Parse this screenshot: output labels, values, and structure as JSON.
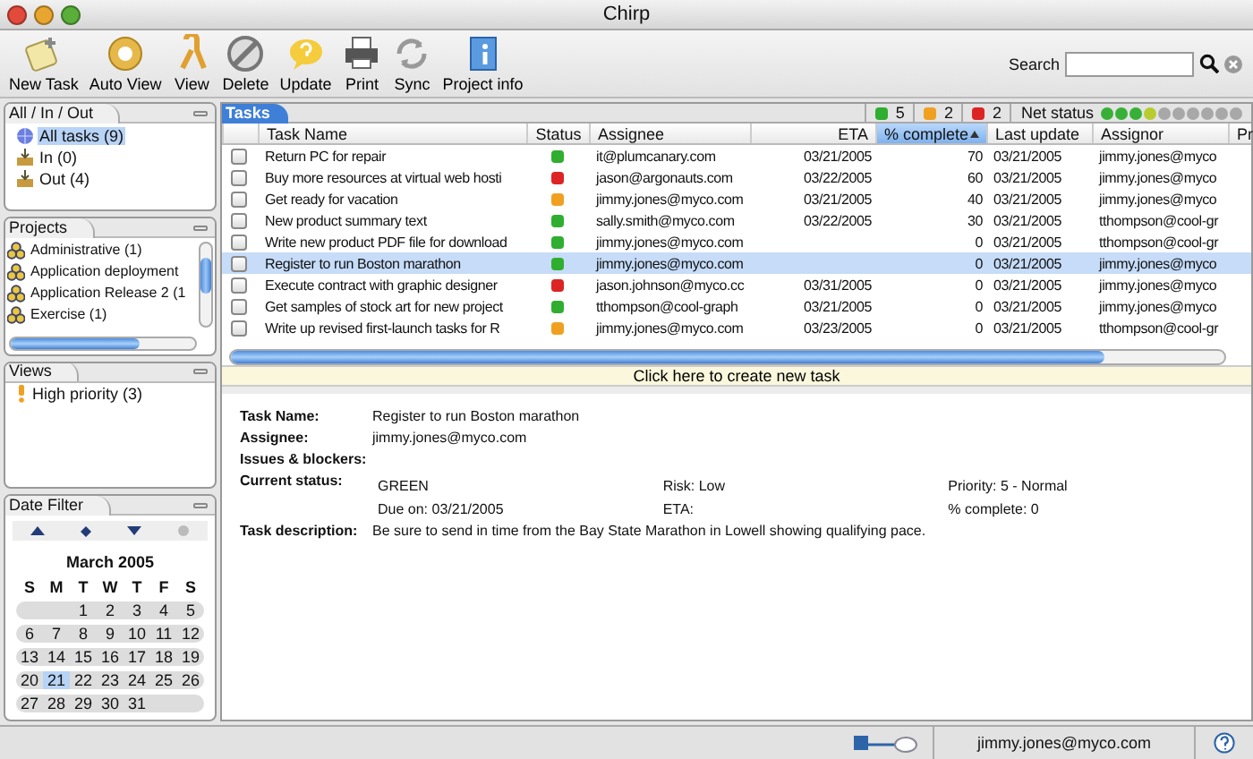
{
  "window": {
    "title": "Chirp"
  },
  "toolbar": [
    {
      "label": "New Task",
      "kind": "new"
    },
    {
      "label": "Auto View",
      "kind": "auto"
    },
    {
      "label": "View",
      "kind": "view"
    },
    {
      "label": "Delete",
      "kind": "delete"
    },
    {
      "label": "Update",
      "kind": "update"
    },
    {
      "label": "Print",
      "kind": "print"
    },
    {
      "label": "Sync",
      "kind": "sync"
    },
    {
      "label": "Project info",
      "kind": "info"
    }
  ],
  "search": {
    "label": "Search"
  },
  "sidebar": [
    {
      "title": "All / In / Out",
      "kind": "list",
      "items": [
        {
          "label": "All tasks (9)",
          "kind": "globe",
          "selected": true
        },
        {
          "label": "In (0)",
          "kind": "tray",
          "selected": false
        },
        {
          "label": "Out (4)",
          "kind": "tray",
          "selected": false
        }
      ]
    },
    {
      "title": "Projects",
      "kind": "scroll",
      "items": [
        {
          "label": "Administrative (1)",
          "kind": "project",
          "selected": false
        },
        {
          "label": "Application deployment",
          "kind": "project",
          "selected": false
        },
        {
          "label": "Application Release 2 (1",
          "kind": "project",
          "selected": false
        },
        {
          "label": "Exercise (1)",
          "kind": "project",
          "selected": false
        }
      ]
    },
    {
      "title": "Views",
      "kind": "list",
      "items": [
        {
          "label": "High priority (3)",
          "kind": "priority",
          "selected": false
        }
      ]
    }
  ],
  "date_filter": {
    "title": "Date Filter",
    "month": "March 2005",
    "weekdays": [
      "S",
      "M",
      "T",
      "W",
      "T",
      "F",
      "S"
    ],
    "weeks": [
      [
        {
          "day": "1",
          "selected": false
        },
        {
          "day": "2",
          "selected": false
        },
        {
          "day": "3",
          "selected": false
        },
        {
          "day": "4",
          "selected": false
        },
        {
          "day": "5",
          "selected": false
        }
      ],
      [
        {
          "day": "6",
          "selected": false
        },
        {
          "day": "7",
          "selected": false
        },
        {
          "day": "8",
          "selected": false
        },
        {
          "day": "9",
          "selected": false
        },
        {
          "day": "10",
          "selected": false
        },
        {
          "day": "11",
          "selected": false
        },
        {
          "day": "12",
          "selected": false
        }
      ],
      [
        {
          "day": "13",
          "selected": false
        },
        {
          "day": "14",
          "selected": false
        },
        {
          "day": "15",
          "selected": false
        },
        {
          "day": "16",
          "selected": false
        },
        {
          "day": "17",
          "selected": false
        },
        {
          "day": "18",
          "selected": false
        },
        {
          "day": "19",
          "selected": false
        }
      ],
      [
        {
          "day": "20",
          "selected": false
        },
        {
          "day": "21",
          "selected": true
        },
        {
          "day": "22",
          "selected": false
        },
        {
          "day": "23",
          "selected": false
        },
        {
          "day": "24",
          "selected": false
        },
        {
          "day": "25",
          "selected": false
        },
        {
          "day": "26",
          "selected": false
        }
      ],
      [
        {
          "day": "27",
          "selected": false
        },
        {
          "day": "28",
          "selected": false
        },
        {
          "day": "29",
          "selected": false
        },
        {
          "day": "30",
          "selected": false
        },
        {
          "day": "31",
          "selected": false
        }
      ]
    ]
  },
  "tasks": {
    "tab": "Tasks",
    "counts": [
      {
        "count": "5",
        "color": "#2fae2f"
      },
      {
        "count": "2",
        "color": "#f0a020"
      },
      {
        "count": "2",
        "color": "#dd2424"
      }
    ],
    "net_status": {
      "label": "Net status",
      "dots": [
        {
          "color": "#38b038"
        },
        {
          "color": "#38b038"
        },
        {
          "color": "#38b038"
        },
        {
          "color": "#b8cc30"
        },
        {
          "color": "#a8a8a8"
        },
        {
          "color": "#a8a8a8"
        },
        {
          "color": "#a8a8a8"
        },
        {
          "color": "#a8a8a8"
        },
        {
          "color": "#a8a8a8"
        },
        {
          "color": "#a8a8a8"
        }
      ]
    },
    "columns": [
      {
        "label": "Task Name",
        "selected": false
      },
      {
        "label": "Status",
        "selected": false
      },
      {
        "label": "Assignee",
        "selected": false
      },
      {
        "label": "ETA",
        "selected": false
      },
      {
        "label": "% complete",
        "selected": true
      },
      {
        "label": "Last update",
        "selected": false
      },
      {
        "label": "Assignor",
        "selected": false
      },
      {
        "label": "Pr",
        "selected": false
      }
    ],
    "rows": [
      {
        "checked": false,
        "selected": false,
        "name": "Return  PC for repair",
        "color": "#2fae2f",
        "assignee": "it@plumcanary.com",
        "eta": "03/21/2005",
        "complete": "70",
        "last_update": "03/21/2005",
        "assignor": "jimmy.jones@myco"
      },
      {
        "checked": false,
        "selected": false,
        "name": "Buy more resources at virtual web hosti",
        "color": "#dd2424",
        "assignee": "jason@argonauts.com",
        "eta": "03/22/2005",
        "complete": "60",
        "last_update": "03/21/2005",
        "assignor": "jimmy.jones@myco"
      },
      {
        "checked": false,
        "selected": false,
        "name": "Get ready for vacation",
        "color": "#f0a020",
        "assignee": "jimmy.jones@myco.com",
        "eta": "03/21/2005",
        "complete": "40",
        "last_update": "03/21/2005",
        "assignor": "jimmy.jones@myco"
      },
      {
        "checked": false,
        "selected": false,
        "name": "New product summary text",
        "color": "#2fae2f",
        "assignee": "sally.smith@myco.com",
        "eta": "03/22/2005",
        "complete": "30",
        "last_update": "03/21/2005",
        "assignor": "tthompson@cool-gr"
      },
      {
        "checked": false,
        "selected": false,
        "name": "Write new product PDF file for download",
        "color": "#2fae2f",
        "assignee": "jimmy.jones@myco.com",
        "complete": "0",
        "last_update": "03/21/2005",
        "assignor": "tthompson@cool-gr"
      },
      {
        "checked": false,
        "selected": true,
        "name": "Register to run Boston marathon",
        "color": "#2fae2f",
        "assignee": "jimmy.jones@myco.com",
        "complete": "0",
        "last_update": "03/21/2005",
        "assignor": "jimmy.jones@myco"
      },
      {
        "checked": false,
        "selected": false,
        "name": "Execute contract with graphic designer",
        "color": "#dd2424",
        "assignee": "jason.johnson@myco.cc",
        "eta": "03/31/2005",
        "complete": "0",
        "last_update": "03/21/2005",
        "assignor": "jimmy.jones@myco"
      },
      {
        "checked": false,
        "selected": false,
        "name": "Get samples of stock art for new project",
        "color": "#2fae2f",
        "assignee": "tthompson@cool-graph",
        "eta": "03/21/2005",
        "complete": "0",
        "last_update": "03/21/2005",
        "assignor": "jimmy.jones@myco"
      },
      {
        "checked": false,
        "selected": false,
        "name": "Write up revised first-launch tasks for R",
        "color": "#f0a020",
        "assignee": "jimmy.jones@myco.com",
        "eta": "03/23/2005",
        "complete": "0",
        "last_update": "03/21/2005",
        "assignor": "tthompson@cool-gr"
      }
    ],
    "create_bar": "Click here to create new task"
  },
  "details": [
    {
      "label": "Task Name:",
      "value": "Register to run Boston marathon"
    },
    {
      "label": "Assignee:",
      "value": "jimmy.jones@myco.com"
    },
    {
      "label": "Issues & blockers:"
    },
    {
      "label": "Current status:",
      "grid": [
        "GREEN",
        "Risk: Low",
        "Priority: 5 - Normal",
        "Due on: 03/21/2005",
        "ETA:",
        "% complete: 0"
      ]
    },
    {
      "label": "Task description:",
      "value": "Be sure to send in time from the Bay State Marathon in Lowell showing qualifying pace."
    }
  ],
  "status_bar": {
    "user": "jimmy.jones@myco.com"
  }
}
